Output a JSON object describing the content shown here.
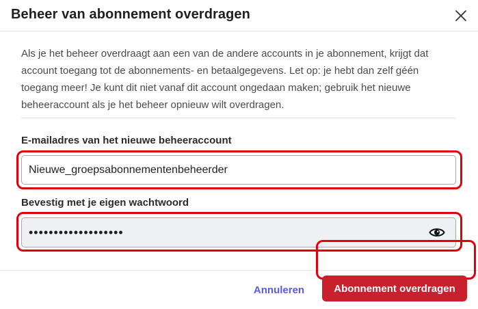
{
  "dialog": {
    "title": "Beheer van abonnement overdragen",
    "description": "Als je het beheer overdraagt aan een van de andere accounts in je abonnement, krijgt dat account toegang tot de abonnements- en betaalgegevens. Let op: je hebt dan zelf géén toegang meer! Je kunt dit niet vanaf dit account ongedaan maken; gebruik het nieuwe beheeraccount als je het beheer opnieuw wilt overdragen.",
    "email": {
      "label": "E-mailadres van het nieuwe beheeraccount",
      "value": "Nieuwe_groepsabonnementenbeheerder"
    },
    "password": {
      "label": "Bevestig met je eigen wachtwoord",
      "value": "•••••••••••••••••••"
    },
    "buttons": {
      "cancel": "Annuleren",
      "submit": "Abonnement overdragen"
    },
    "icons": {
      "close": "close-icon",
      "eye": "eye-icon"
    },
    "colors": {
      "primary": "#c8202d",
      "link": "#5a5adf",
      "highlight": "#e0000b"
    }
  }
}
